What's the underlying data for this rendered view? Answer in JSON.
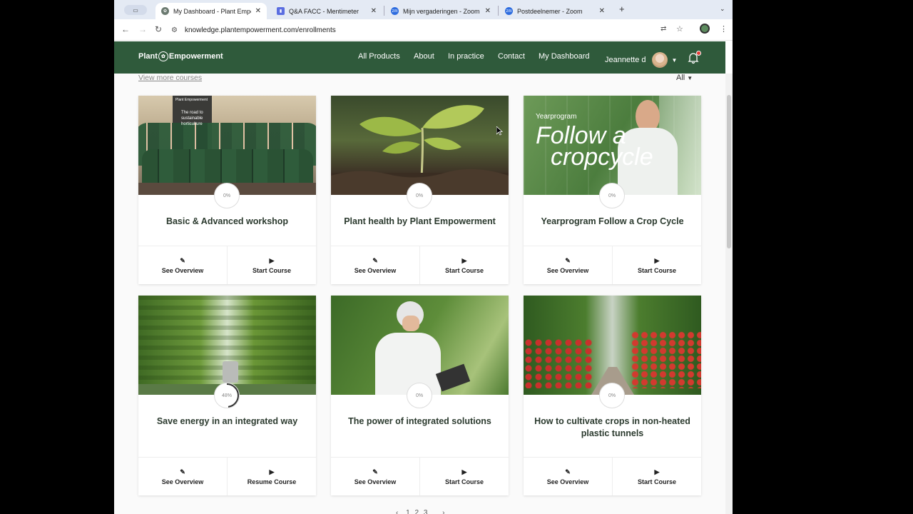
{
  "browser": {
    "tabs": [
      {
        "title": "My Dashboard - Plant Empowerment",
        "active": true
      },
      {
        "title": "Q&A FACC - Mentimeter",
        "active": false
      },
      {
        "title": "Mijn vergaderingen - Zoom",
        "active": false
      },
      {
        "title": "Postdeelnemer - Zoom",
        "active": false
      }
    ],
    "new_tab": "+",
    "url": "knowledge.plantempowerment.com/enrollments"
  },
  "site": {
    "logo_left": "Plant",
    "logo_right": "Empowerment",
    "nav": [
      "All Products",
      "About",
      "In practice",
      "Contact",
      "My Dashboard"
    ],
    "user_name": "Jeannette d"
  },
  "page": {
    "view_more": "View more courses",
    "filter": "All",
    "pager": [
      "‹",
      "1",
      "2",
      "3",
      "›"
    ]
  },
  "courses": [
    {
      "title": "Basic & Advanced workshop",
      "progress": "0%",
      "overview": "See Overview",
      "action": "Start Course",
      "banner_small": "Plant Empowerment",
      "banner_text": "The road to sustainable horticulture"
    },
    {
      "title": "Plant health by Plant Empowerment",
      "progress": "0%",
      "overview": "See Overview",
      "action": "Start Course"
    },
    {
      "title": "Yearprogram Follow a Crop Cycle",
      "progress": "0%",
      "overview": "See Overview",
      "action": "Start Course",
      "banner_small": "Yearprogram",
      "banner_line1": "Follow a",
      "banner_line2": "cropcycle"
    },
    {
      "title": "Save energy in an integrated way",
      "progress": "48%",
      "progress_value": 0.48,
      "overview": "See Overview",
      "action": "Resume Course"
    },
    {
      "title": "The power of integrated solutions",
      "progress": "0%",
      "overview": "See Overview",
      "action": "Start Course"
    },
    {
      "title": "How to cultivate crops in non-heated plastic tunnels",
      "progress": "0%",
      "overview": "See Overview",
      "action": "Start Course"
    }
  ],
  "colors": {
    "header": "#2f5a3b",
    "title": "#2b3a2e",
    "accent": "#e53935"
  }
}
